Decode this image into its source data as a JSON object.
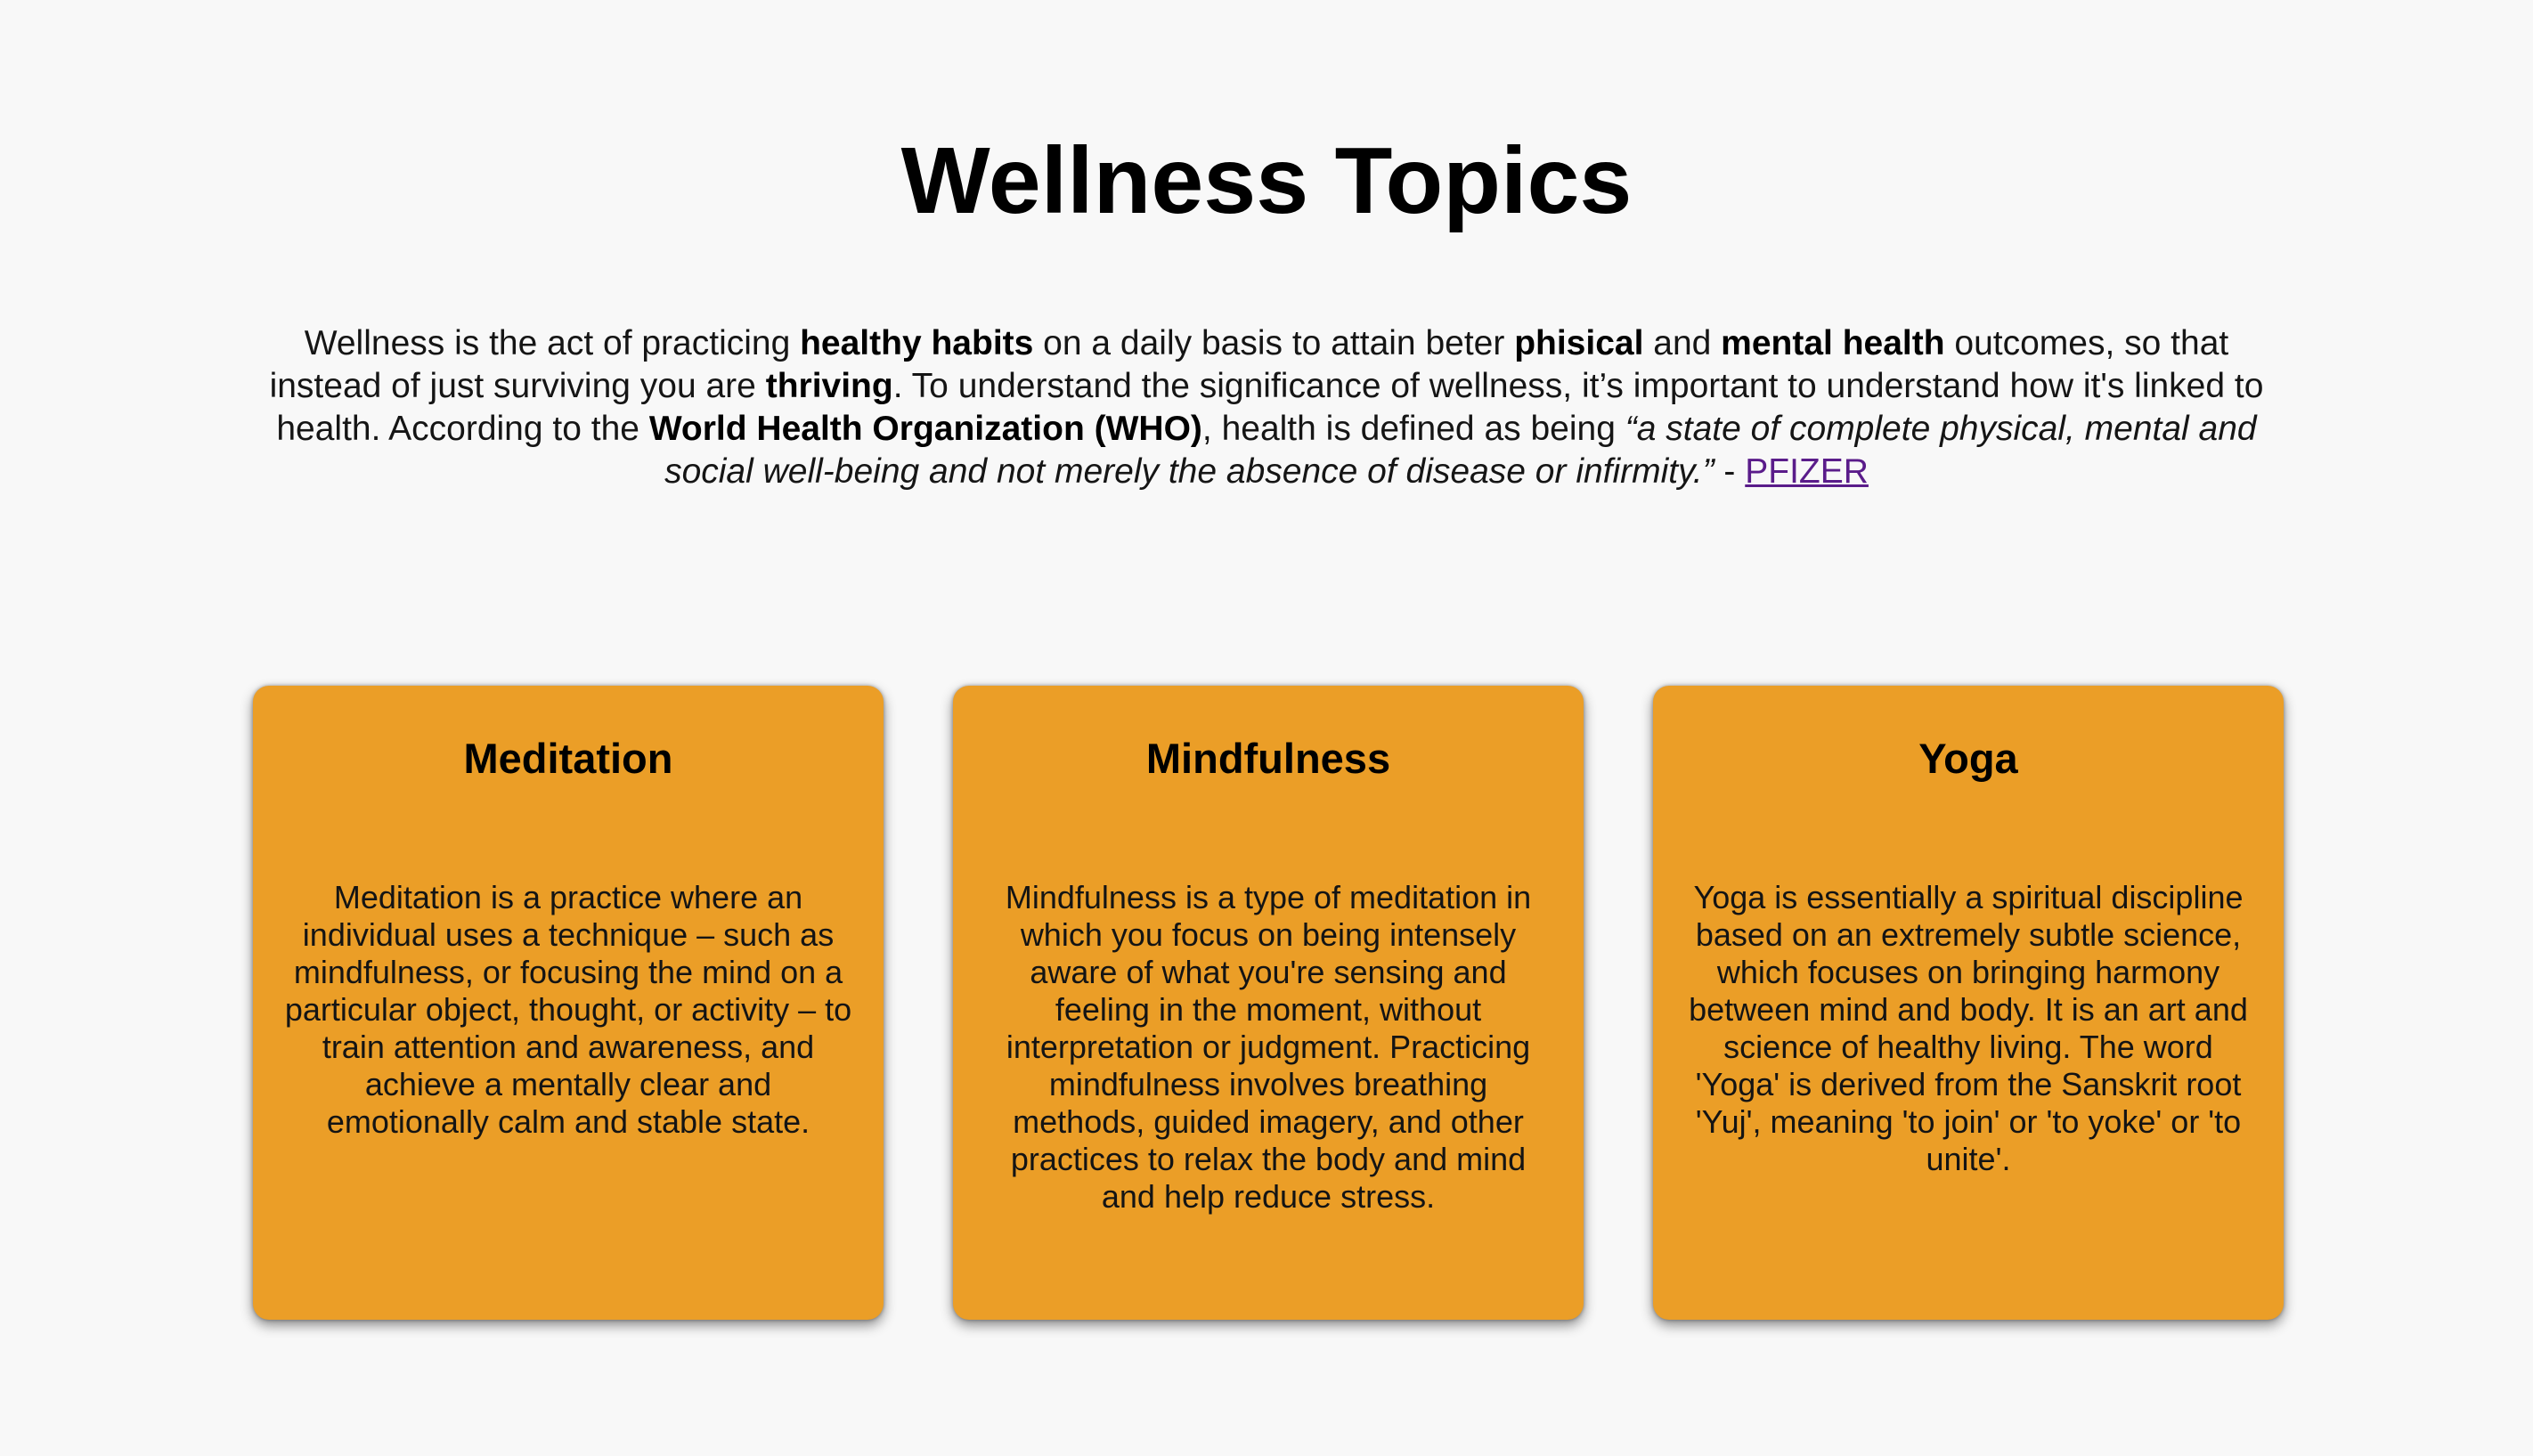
{
  "page": {
    "title": "Wellness Topics"
  },
  "intro": {
    "t1": "Wellness is the act of practicing ",
    "b1": "healthy habits",
    "t2": " on a daily basis to attain beter ",
    "b2": "phisical",
    "t3": " and ",
    "b3": "mental health",
    "t4": " outcomes, so that instead of just surviving you are ",
    "b4": "thriving",
    "t5": ". To understand the significance of wellness, it’s important to understand how it's linked to health. According to the ",
    "b5": "World Health Organization (WHO)",
    "t6": ", health is defined as being ",
    "quote": "“a state of complete physical, mental and social well-being and not merely the absence of disease or infirmity.”",
    "t7": " - ",
    "link": "PFIZER"
  },
  "cards": [
    {
      "title": "Meditation",
      "text": "Meditation is a practice where an individual uses a technique – such as mindfulness, or focusing the mind on a particular object, thought, or activity – to train attention and awareness, and achieve a mentally clear and emotionally calm and stable state."
    },
    {
      "title": "Mindfulness",
      "text": "Mindfulness is a type of meditation in which you focus on being intensely aware of what you're sensing and feeling in the moment, without interpretation or judgment. Practicing mindfulness involves breathing methods, guided imagery, and other practices to relax the body and mind and help reduce stress."
    },
    {
      "title": "Yoga",
      "text": "Yoga is essentially a spiritual discipline based on an extremely subtle science, which focuses on bringing harmony between mind and body. It is an art and science of healthy living. The word 'Yoga' is derived from the Sanskrit root 'Yuj', meaning 'to join' or 'to yoke' or 'to unite'."
    }
  ],
  "colors": {
    "background": "#f8f8f8",
    "card": "#eb9e27",
    "link": "#5a1c8a"
  }
}
